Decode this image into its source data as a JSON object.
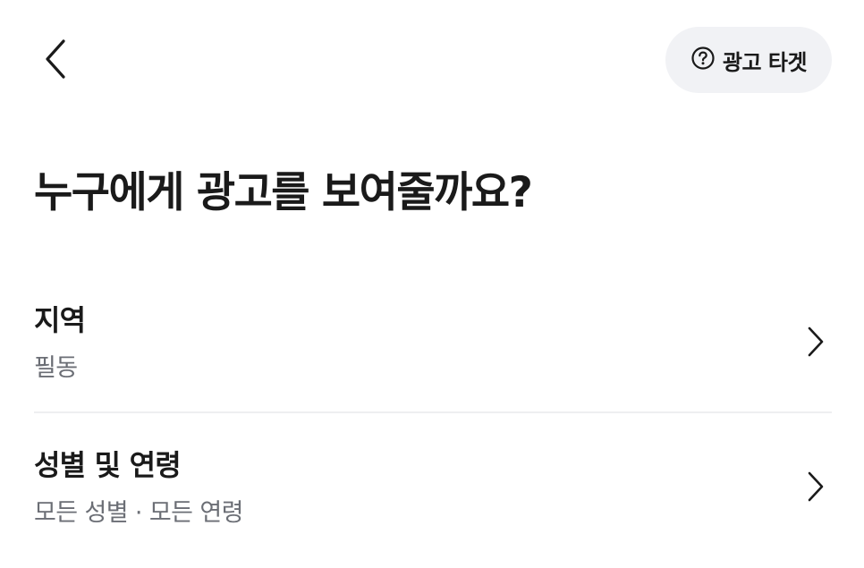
{
  "header": {
    "back_icon": "chevron-left-icon",
    "help_icon": "question-circle-icon",
    "help_label": "광고 타겟"
  },
  "page": {
    "title": "누구에게 광고를 보여줄까요?"
  },
  "settings": [
    {
      "title": "지역",
      "value": "필동",
      "icon": "chevron-right-icon"
    },
    {
      "title": "성별 및 연령",
      "value": "모든 성별 · 모든 연령",
      "icon": "chevron-right-icon"
    }
  ],
  "colors": {
    "text_primary": "#1a1a1a",
    "text_secondary": "#6b6e75",
    "pill_background": "#f1f2f5",
    "divider": "#eeeff1"
  }
}
